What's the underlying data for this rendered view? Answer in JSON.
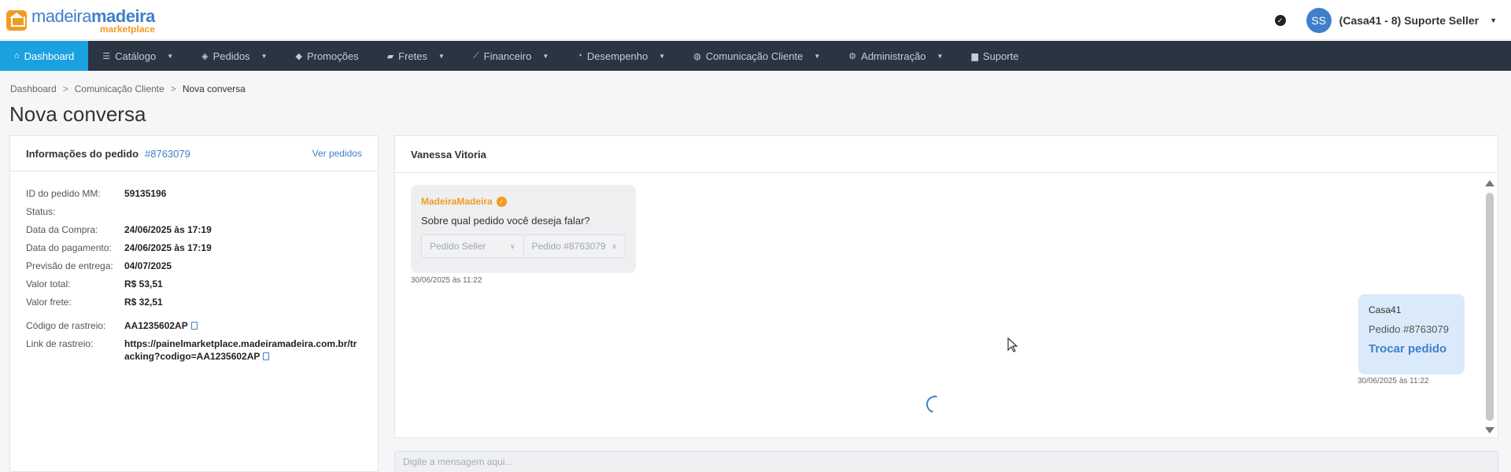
{
  "header": {
    "logo": {
      "word1": "madeira",
      "word2": "madeira",
      "sub": "marketplace"
    },
    "status_icon": "check-circle-icon",
    "avatar_initials": "SS",
    "user_label": "(Casa41 - 8) Suporte Seller"
  },
  "nav": {
    "items": [
      {
        "label": "Dashboard",
        "icon": "⌂",
        "active": true,
        "caret": false
      },
      {
        "label": "Catálogo",
        "icon": "☰",
        "caret": true
      },
      {
        "label": "Pedidos",
        "icon": "◈",
        "caret": true
      },
      {
        "label": "Promoções",
        "icon": "◆",
        "caret": false
      },
      {
        "label": "Fretes",
        "icon": "▰",
        "caret": true
      },
      {
        "label": "Financeiro",
        "icon": "⟋",
        "caret": true
      },
      {
        "label": "Desempenho",
        "icon": "◔",
        "caret": true
      },
      {
        "label": "Comunicação Cliente",
        "icon": "◍",
        "caret": true
      },
      {
        "label": "Administração",
        "icon": "⚙",
        "caret": true
      },
      {
        "label": "Suporte",
        "icon": "▆",
        "caret": false
      }
    ]
  },
  "breadcrumb": [
    "Dashboard",
    "Comunicação Cliente",
    "Nova conversa"
  ],
  "page_title": "Nova conversa",
  "order_panel": {
    "title": "Informações do pedido",
    "order_number": "#8763079",
    "link": "Ver pedidos",
    "rows": [
      {
        "label": "ID do pedido MM:",
        "value": "59135196"
      },
      {
        "label": "Status:",
        "value": ""
      },
      {
        "label": "Data da Compra:",
        "value": "24/06/2025 às 17:19"
      },
      {
        "label": "Data do pagamento:",
        "value": "24/06/2025 às 17:19"
      },
      {
        "label": "Previsão de entrega:",
        "value": "04/07/2025"
      },
      {
        "label": "Valor total:",
        "value": "R$ 53,51"
      },
      {
        "label": "Valor frete:",
        "value": "R$ 32,51"
      },
      {
        "label": "Código de rastreio:",
        "value": "AA1235602AP"
      },
      {
        "label": "Link de rastreio:",
        "value": "https://painelmarketplace.madeiramadeira.com.br/tracking?codigo=AA1235602AP"
      }
    ]
  },
  "chat": {
    "contact": "Vanessa Vitoria",
    "incoming": {
      "sender": "MadeiraMadeira",
      "text": "Sobre qual pedido você deseja falar?",
      "option1": "Pedido Seller",
      "option2": "Pedido #8763079",
      "time": "30/06/2025 às 11:22"
    },
    "outgoing": {
      "sender": "Casa41",
      "order": "Pedido #8763079",
      "action": "Trocar pedido",
      "time": "30/06/2025 às 11:22"
    },
    "input_placeholder": "Digite a mensagem aqui..."
  },
  "colors": {
    "nav_bg": "#2b3441",
    "nav_active": "#1ba1e0",
    "brand_blue": "#3f7fca",
    "brand_orange": "#f39a23"
  }
}
